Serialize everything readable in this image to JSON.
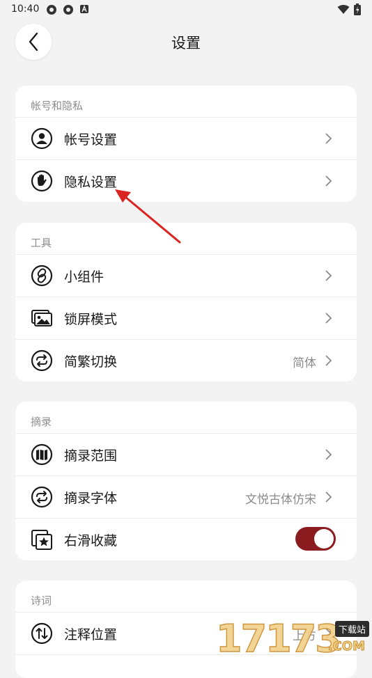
{
  "status": {
    "time": "10:40"
  },
  "header": {
    "title": "设置"
  },
  "sections": [
    {
      "title": "帐号和隐私",
      "items": [
        {
          "icon": "user-circle-icon",
          "label": "帐号设置"
        },
        {
          "icon": "hand-stop-icon",
          "label": "隐私设置"
        }
      ]
    },
    {
      "title": "工具",
      "items": [
        {
          "icon": "link-circle-icon",
          "label": "小组件"
        },
        {
          "icon": "image-gallery-icon",
          "label": "锁屏模式"
        },
        {
          "icon": "swap-circle-icon",
          "label": "简繁切换",
          "value": "简体"
        }
      ]
    },
    {
      "title": "摘录",
      "items": [
        {
          "icon": "book-circle-icon",
          "label": "摘录范围"
        },
        {
          "icon": "swap-circle-icon",
          "label": "摘录字体",
          "value": "文悦古体仿宋"
        },
        {
          "icon": "star-stack-icon",
          "label": "右滑收藏",
          "toggle": true
        }
      ]
    },
    {
      "title": "诗词",
      "items": [
        {
          "icon": "sort-circle-icon",
          "label": "注释位置",
          "value": "上方"
        }
      ]
    }
  ],
  "watermark": {
    "digits": "17173",
    "badge": "下载站",
    "domain": ".COM"
  },
  "colors": {
    "accent": "#8a1c20",
    "background": "#f3f3f3",
    "annotation": "#d9241f"
  }
}
